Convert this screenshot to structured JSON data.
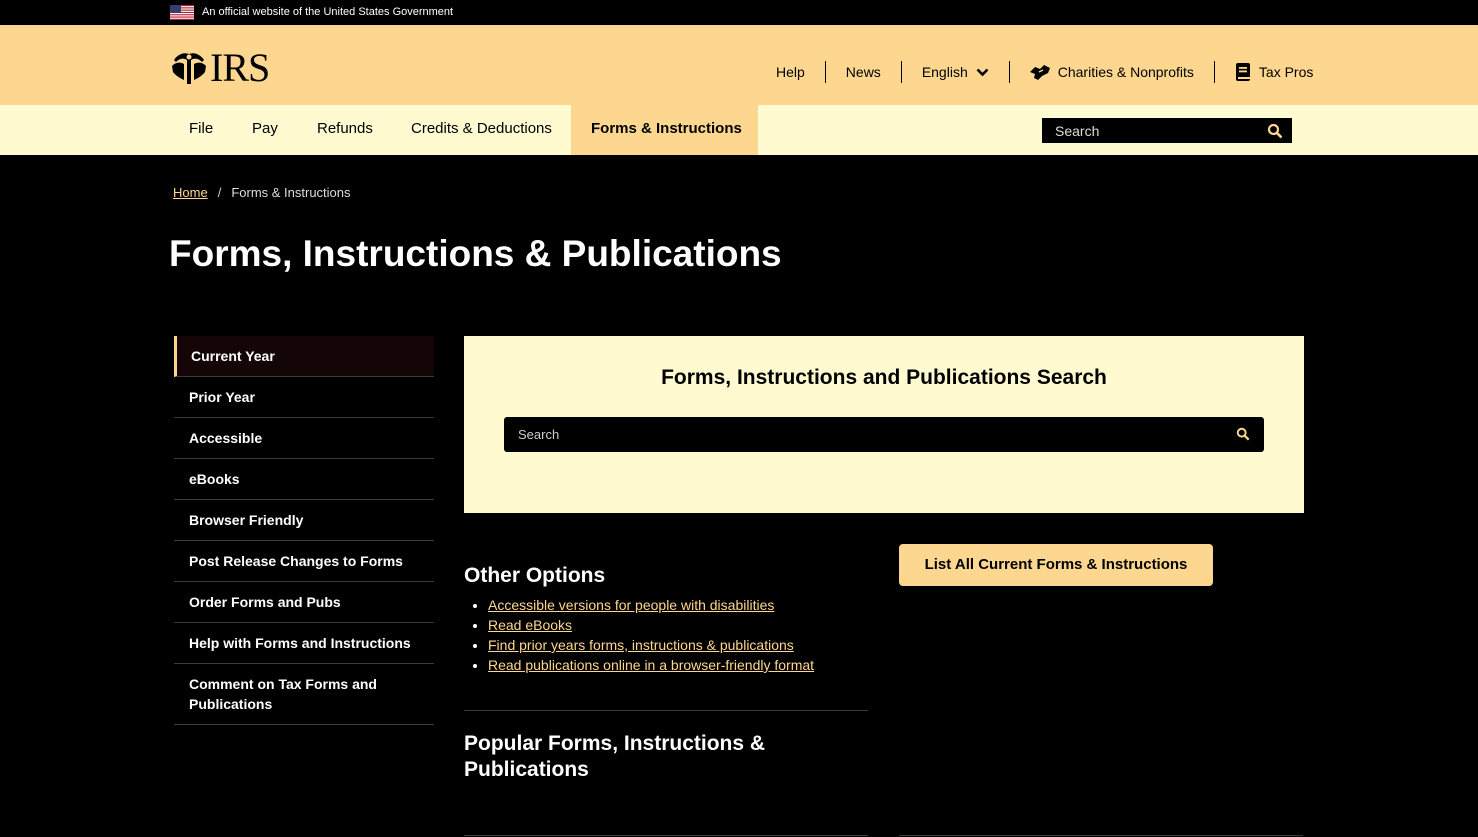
{
  "gov_banner": {
    "flag_icon": "us-flag-icon",
    "text": "An official website of the United States Government"
  },
  "header": {
    "logo_text": "IRS",
    "logo_icon": "irs-eagle-icon",
    "util_nav": [
      {
        "label": "Help"
      },
      {
        "label": "News"
      },
      {
        "label": "English",
        "icon": "chevron-down-icon"
      },
      {
        "label": "Charities & Nonprofits",
        "icon": "handshake-icon"
      },
      {
        "label": "Tax Pros",
        "icon": "book-icon"
      }
    ]
  },
  "main_nav": {
    "items": [
      {
        "label": "File"
      },
      {
        "label": "Pay"
      },
      {
        "label": "Refunds"
      },
      {
        "label": "Credits & Deductions"
      },
      {
        "label": "Forms & Instructions",
        "active": true
      }
    ],
    "search_placeholder": "Search"
  },
  "breadcrumb": {
    "home": "Home",
    "separator": "/",
    "current": "Forms & Instructions"
  },
  "page_title": "Forms, Instructions & Publications",
  "side_nav": {
    "items": [
      {
        "label": "Current Year",
        "current": true
      },
      {
        "label": "Prior Year"
      },
      {
        "label": "Accessible"
      },
      {
        "label": "eBooks"
      },
      {
        "label": "Browser Friendly"
      },
      {
        "label": "Post Release Changes to Forms"
      },
      {
        "label": "Order Forms and Pubs"
      },
      {
        "label": "Help with Forms and Instructions"
      },
      {
        "label": "Comment on Tax Forms and Publications"
      }
    ]
  },
  "search_panel": {
    "title": "Forms, Instructions and Publications Search",
    "placeholder": "Search"
  },
  "other_options": {
    "title": "Other Options",
    "links": [
      "Accessible versions for people with disabilities",
      "Read eBooks",
      "Find prior years forms, instructions & publications",
      "Read publications online in a browser-friendly format"
    ]
  },
  "popular": {
    "title": "Popular Forms, Instructions & Publications"
  },
  "list_all_button": "List All Current Forms & Instructions",
  "colors": {
    "header_bg": "#fdd78f",
    "nav_bg": "#fffad0",
    "page_bg": "#000000",
    "link": "#fdd78f"
  }
}
